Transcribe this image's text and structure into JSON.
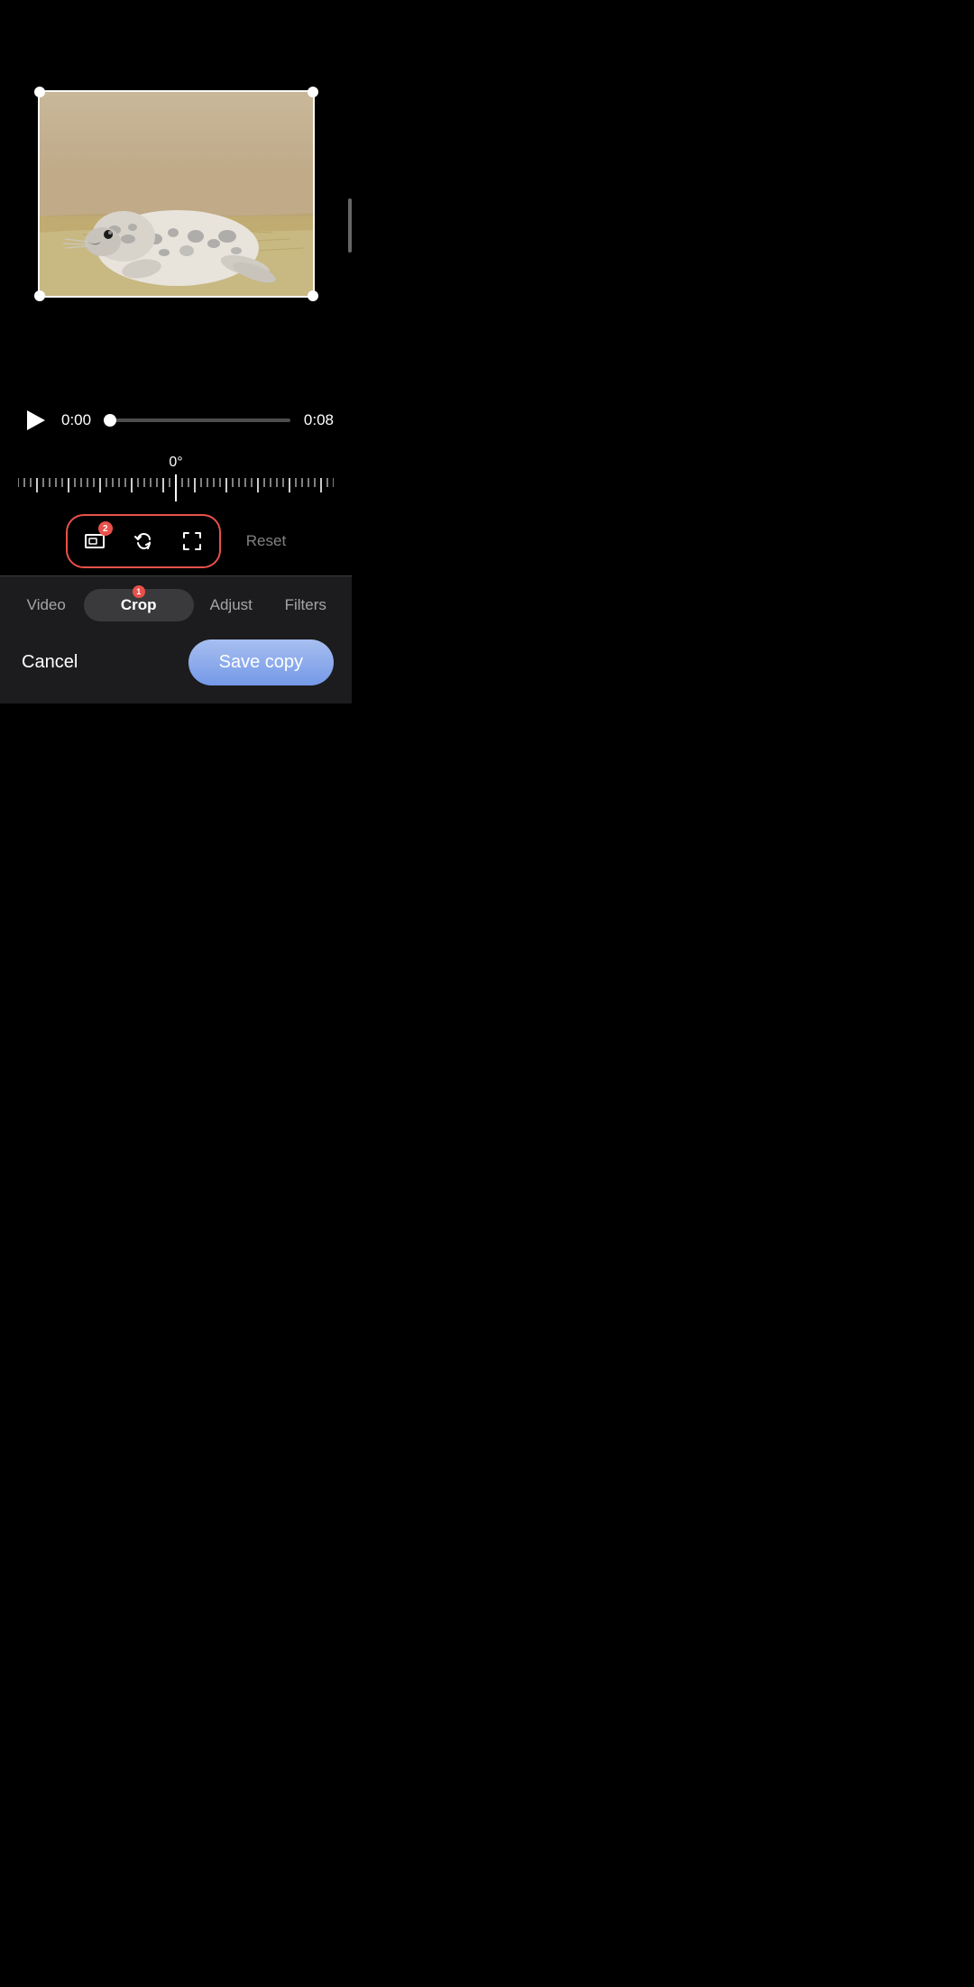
{
  "video": {
    "time_current": "0:00",
    "time_total": "0:08",
    "rotation_degree": "0°",
    "progress_percent": 3
  },
  "tools": {
    "badge_1": "2",
    "reset_label": "Reset"
  },
  "tabs": [
    {
      "id": "video",
      "label": "Video",
      "active": false
    },
    {
      "id": "crop",
      "label": "Crop",
      "active": true,
      "badge": "1"
    },
    {
      "id": "adjust",
      "label": "Adjust",
      "active": false
    },
    {
      "id": "filters",
      "label": "Filters",
      "active": false
    }
  ],
  "actions": {
    "cancel_label": "Cancel",
    "save_label": "Save copy"
  }
}
